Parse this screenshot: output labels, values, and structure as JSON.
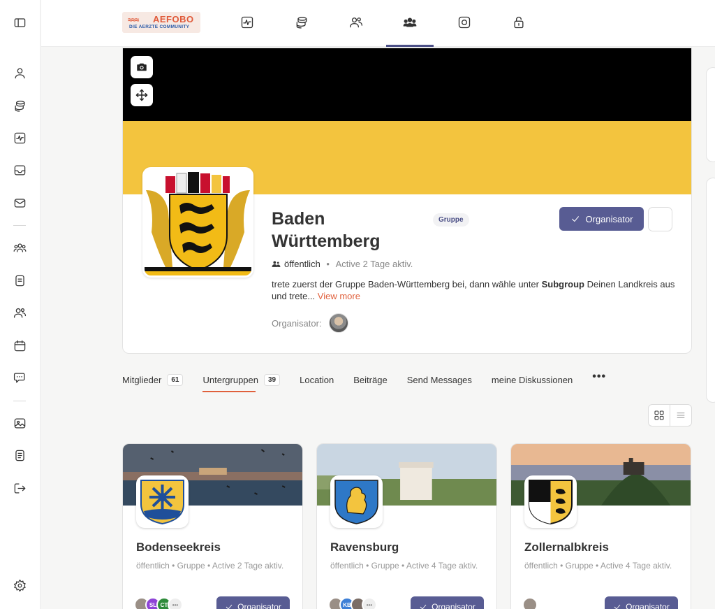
{
  "header": {
    "logo_brand": "AEFOBO",
    "logo_tagline": "DIE AERZTE COMMUNITY"
  },
  "rail_icons": [
    "sidebar-toggle-icon",
    "profile-icon",
    "coins-icon",
    "activity-icon",
    "inbox-icon",
    "mail-icon",
    "groups-icon",
    "document-icon",
    "friends-icon",
    "calendar-icon",
    "chat-icon",
    "photos-icon",
    "notes-icon",
    "logout-icon",
    "settings-icon"
  ],
  "group": {
    "name": "Baden Württemberg",
    "type_badge": "Gruppe",
    "join_button": "Organisator",
    "visibility": "öffentlich",
    "activity": "Active 2 Tage aktiv.",
    "description_pre": "trete zuerst der Gruppe Baden-Württemberg bei, dann wähle unter ",
    "description_bold": "Subgroup",
    "description_post": " Deinen Landkreis aus und trete...",
    "view_more": "View more",
    "organizer_label": "Organisator:",
    "cover_colors": {
      "top": "#000000",
      "bottom": "#f3c43e"
    }
  },
  "tabs": [
    {
      "label": "Mitglieder",
      "count": "61"
    },
    {
      "label": "Untergruppen",
      "count": "39",
      "active": true
    },
    {
      "label": "Location"
    },
    {
      "label": "Beiträge"
    },
    {
      "label": "Send Messages"
    },
    {
      "label": "meine Diskussionen"
    },
    {
      "label": "•••"
    }
  ],
  "subgroups": [
    {
      "name": "Bodenseekreis",
      "meta": "öffentlich  •  Gruppe  •  Active 2 Tage aktiv.",
      "button": "Organisator",
      "member_initials": [
        "",
        "SL",
        "CT",
        "•••"
      ]
    },
    {
      "name": "Ravensburg",
      "meta": "öffentlich  •  Gruppe  •  Active 4 Tage aktiv.",
      "button": "Organisator",
      "member_initials": [
        "",
        "KB",
        "",
        "•••"
      ]
    },
    {
      "name": "Zollernalbkreis",
      "meta": "öffentlich  •  Gruppe  •  Active 4 Tage aktiv.",
      "button": "Organisator",
      "member_initials": [
        ""
      ]
    }
  ],
  "colors": {
    "accent": "#585c93",
    "link": "#e0603c"
  }
}
